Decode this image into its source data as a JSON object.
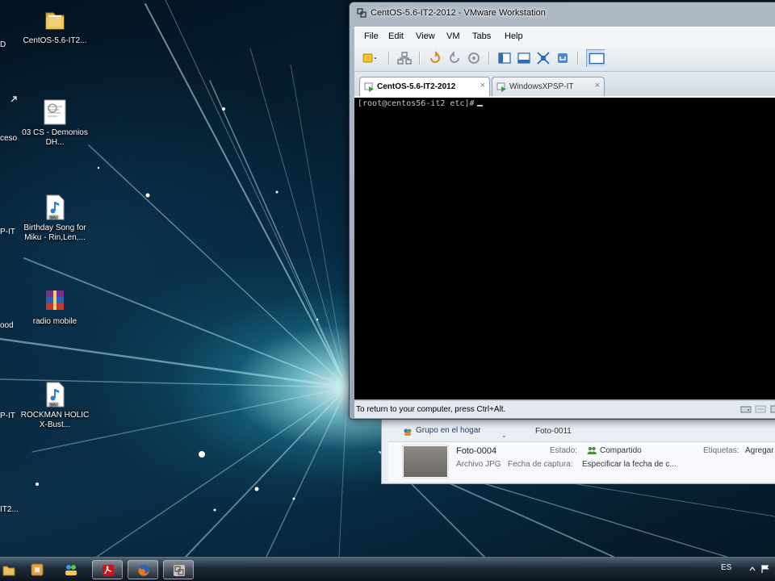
{
  "desktop": {
    "icons": [
      {
        "label": "CentOS-5.6-IT2..."
      },
      {
        "label": "03 CS - Demonios DH..."
      },
      {
        "label": "Birthday Song for Miku - Rin,Len,..."
      },
      {
        "label": "radio mobile"
      },
      {
        "label": "ROCKMAN HOLIC X-Bust..."
      }
    ],
    "cut_labels": [
      "D",
      "ceso",
      "P-IT",
      "ood",
      "P-IT",
      "IT2..."
    ]
  },
  "vmware": {
    "title": "CentOS-5.6-IT2-2012 - VMware Workstation",
    "menu": [
      "File",
      "Edit",
      "View",
      "VM",
      "Tabs",
      "Help"
    ],
    "tabs": [
      {
        "label": "CentOS-5.6-IT2-2012",
        "active": true
      },
      {
        "label": "WindowsXPSP-IT",
        "active": false
      }
    ],
    "tab_close_glyph": "×",
    "console": {
      "prompt": "[root@centos56-it2 etc]#"
    },
    "status_text": "To return to your computer, press Ctrl+Alt."
  },
  "explorer": {
    "nav_item": "Grupo en el hogar",
    "column_photo": "Foto-0011",
    "file": {
      "name": "Foto-0004",
      "type": "Archivo JPG",
      "capture_date_label": "Fecha de captura:",
      "capture_date_value": "Especificar la fecha de c...",
      "state_label": "Estado:",
      "state_value": "Compartido",
      "tags_label": "Etiquetas:",
      "tags_value": "Agregar"
    }
  },
  "taskbar": {
    "language": "ES"
  }
}
